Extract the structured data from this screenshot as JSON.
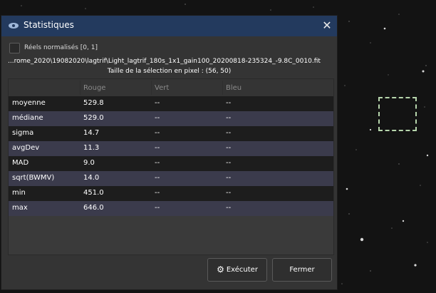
{
  "dialog": {
    "title": "Statistiques",
    "checkbox_label": "Réels normalisés [0, 1]",
    "file_path": "...rome_2020\\19082020\\lagtrif\\Light_lagtrif_180s_1x1_gain100_20200818-235324_-9.8C_0010.fit",
    "selection_size": "Taille de la sélection en pixel : (56, 50)"
  },
  "table": {
    "headers": [
      "",
      "Rouge",
      "Vert",
      "Bleu"
    ],
    "rows": [
      [
        "moyenne",
        "529.8",
        "--",
        "--"
      ],
      [
        "médiane",
        "529.0",
        "--",
        "--"
      ],
      [
        "sigma",
        "14.7",
        "--",
        "--"
      ],
      [
        "avgDev",
        "11.3",
        "--",
        "--"
      ],
      [
        "MAD",
        "9.0",
        "--",
        "--"
      ],
      [
        "sqrt(BWMV)",
        "14.0",
        "--",
        "--"
      ],
      [
        "min",
        "451.0",
        "--",
        "--"
      ],
      [
        "max",
        "646.0",
        "--",
        "--"
      ]
    ]
  },
  "buttons": {
    "run": "Exécuter",
    "close": "Fermer"
  },
  "icons": {
    "app": "app-icon",
    "close": "close-icon",
    "run": "gear-icon"
  }
}
